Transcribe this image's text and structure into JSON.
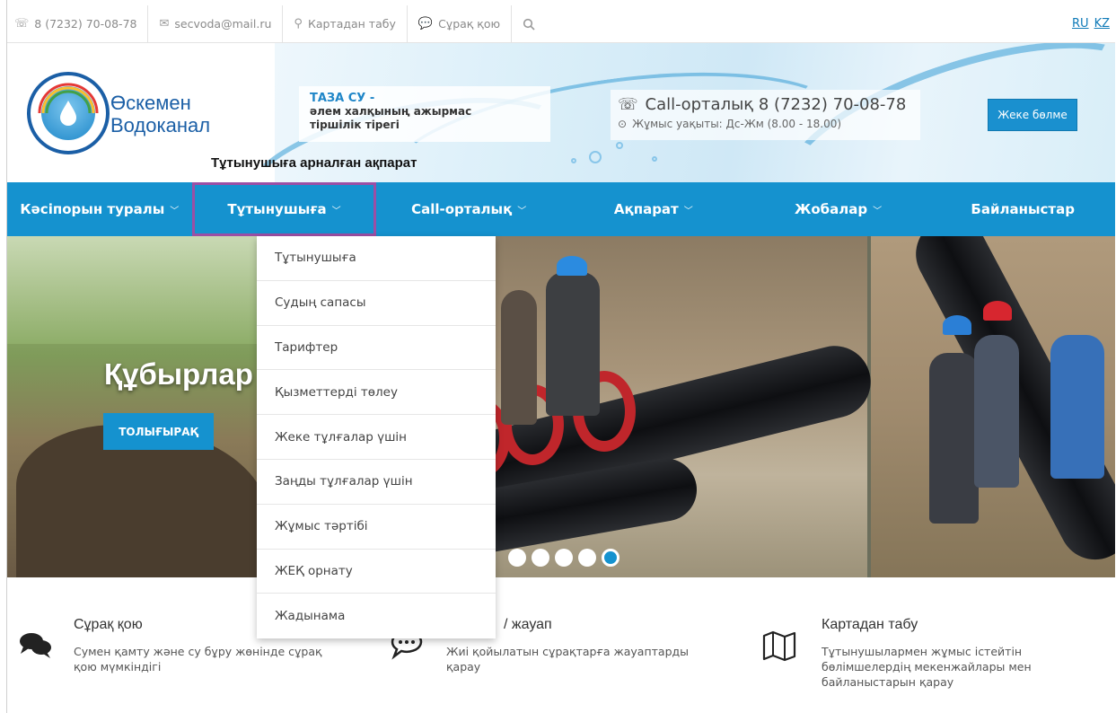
{
  "topbar": {
    "phone": "8 (7232) 70-08-78",
    "email": "secvoda@mail.ru",
    "map": "Картадан табу",
    "ask": "Сұрақ қою",
    "lang_ru": "RU",
    "lang_kz": "KZ"
  },
  "header": {
    "brand_line1": "Өскемен",
    "brand_line2": "Водоканал",
    "slogan_title": "ТАЗА СУ -",
    "slogan_line1": "әлем халқының ажырмас",
    "slogan_line2": "тіршілік тірегі",
    "tagline": "Тұтынушыға арналған ақпарат",
    "call_center": "Call-орталық 8 (7232) 70-08-78",
    "work_hours": "Жұмыс уақыты: Дс-Жм (8.00 - 18.00)",
    "cabinet_button": "Жеке бөлме"
  },
  "nav": {
    "items": [
      {
        "label": "Кәсіпорын туралы"
      },
      {
        "label": "Тұтынушыға"
      },
      {
        "label": "Call-орталық"
      },
      {
        "label": "Ақпарат"
      },
      {
        "label": "Жобалар"
      },
      {
        "label": "Байланыстар"
      }
    ]
  },
  "dropdown": {
    "items": [
      "Тұтынушыға",
      "Судың сапасы",
      "Тарифтер",
      "Қызметтерді төлеу",
      "Жеке тұлғалар үшін",
      "Заңды тұлғалар үшін",
      "Жұмыс тәртібі",
      "ЖЕҚ орнату",
      "Жадынама"
    ]
  },
  "slider": {
    "title": "Құбырлар",
    "more_button": "ТОЛЫҒЫРАҚ",
    "slides_count": 5,
    "active_slide": 5
  },
  "features": [
    {
      "title": "Сұрақ қою",
      "desc_line1": "Сумен қамту және су бұру жөнінде сұрақ",
      "desc_line2": "қою мүмкіндігі",
      "desc_line3": ""
    },
    {
      "title": "/ жауап",
      "desc_line1": "Жиі қойылатын сұрақтарға жауаптарды",
      "desc_line2": "қарау",
      "desc_line3": ""
    },
    {
      "title": "Картадан табу",
      "desc_line1": "Тұтынушылармен жұмыс істейтін",
      "desc_line2": "бөлімшелердің мекенжайлары мен",
      "desc_line3": "байланыстарын қарау"
    }
  ],
  "colors": {
    "primary": "#1592cf",
    "highlight": "#9b4fa5",
    "brand": "#1b5fa6"
  }
}
